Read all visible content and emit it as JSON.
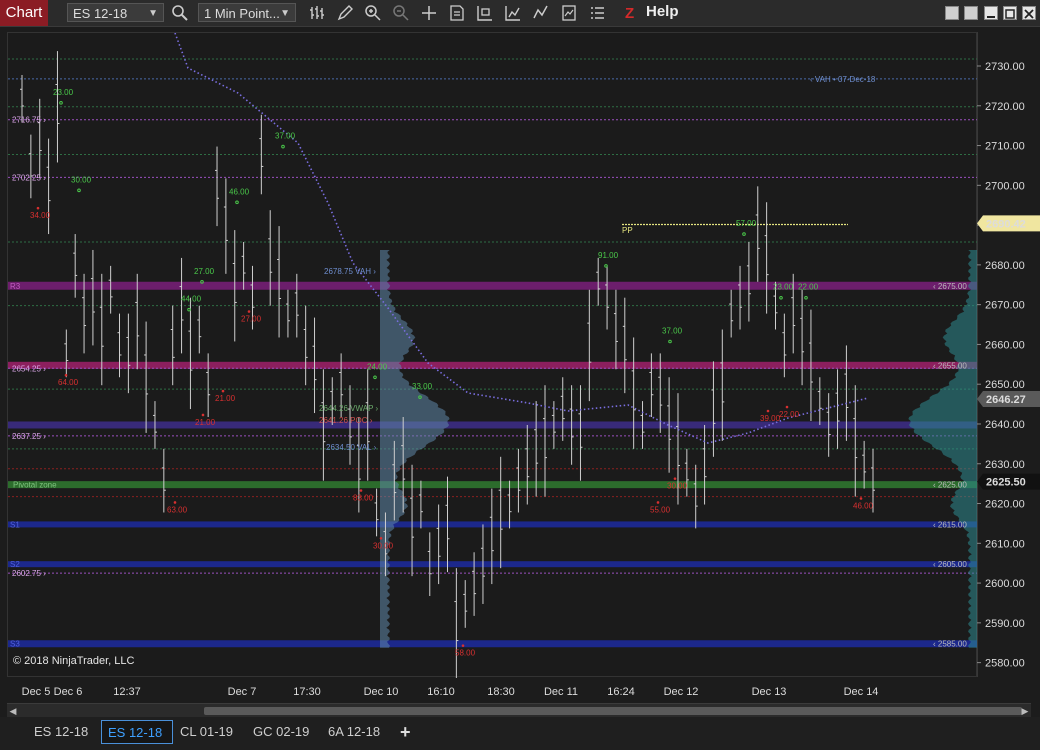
{
  "toolbar": {
    "title": "Chart",
    "instrument": "ES 12-18",
    "interval": "1 Min Point...",
    "help": "Help",
    "icons": [
      "search-icon",
      "bar-type-icon",
      "draw-pencil-icon",
      "zoom-in-icon",
      "zoom-out-icon",
      "crosshair-icon",
      "data-box-icon",
      "chart-properties-icon",
      "strategies-icon",
      "indicators-icon",
      "templates-icon",
      "list-icon",
      "z-order-icon"
    ]
  },
  "chart": {
    "copyright": "© 2018 NinjaTrader, LLC",
    "current_price": "2646.27",
    "last_price": "2625.50",
    "pp_price": "2690.42",
    "pp_label": "PP",
    "vah_top": "VAH • 07-Dec-18",
    "zone_label": "Pivotal zone",
    "r3_label": "R3",
    "s1_label": "S1",
    "s2_label": "S2",
    "s3_label": "S3",
    "right_level_labels": [
      "2675.00",
      "2655.00",
      "2625.00",
      "2615.00",
      "2605.00",
      "2585.00"
    ],
    "left_level_labels": [
      "2716.75",
      "2702.25",
      "2654.25",
      "2637.25",
      "2602.75"
    ],
    "profile_labels": {
      "vah": "2678.75 VAH",
      "vwap": "2644.26 VWAP",
      "poc": "2641.26 POC",
      "val": "2634.50 VAL"
    },
    "price_ticks": [
      "2730.00",
      "2720.00",
      "2710.00",
      "2700.00",
      "2690.00",
      "2680.00",
      "2670.00",
      "2660.00",
      "2650.00",
      "2640.00",
      "2630.00",
      "2620.00",
      "2610.00",
      "2600.00",
      "2590.00",
      "2580.00"
    ],
    "swing_labels_green": [
      "23.00",
      "30.00",
      "27.00",
      "44.00",
      "46.00",
      "37.00",
      "24.00",
      "33.00",
      "91.00",
      "37.00",
      "57.00",
      "23.00",
      "22.00"
    ],
    "swing_labels_red": [
      "34.00",
      "64.00",
      "21.00",
      "27.00",
      "21.00",
      "63.00",
      "83.00",
      "30.00",
      "58.00",
      "30.00",
      "55.00",
      "39.00",
      "22.00",
      "46.00"
    ]
  },
  "time_axis": [
    "Dec 5",
    "Dec 6",
    "12:37",
    "Dec 7",
    "17:30",
    "Dec 10",
    "16:10",
    "18:30",
    "Dec 11",
    "16:24",
    "Dec 12",
    "Dec 13",
    "Dec 14"
  ],
  "tabs": [
    "ES 12-18",
    "ES 12-18",
    "CL 01-19",
    "GC 02-19",
    "6A 12-18",
    "+"
  ]
}
